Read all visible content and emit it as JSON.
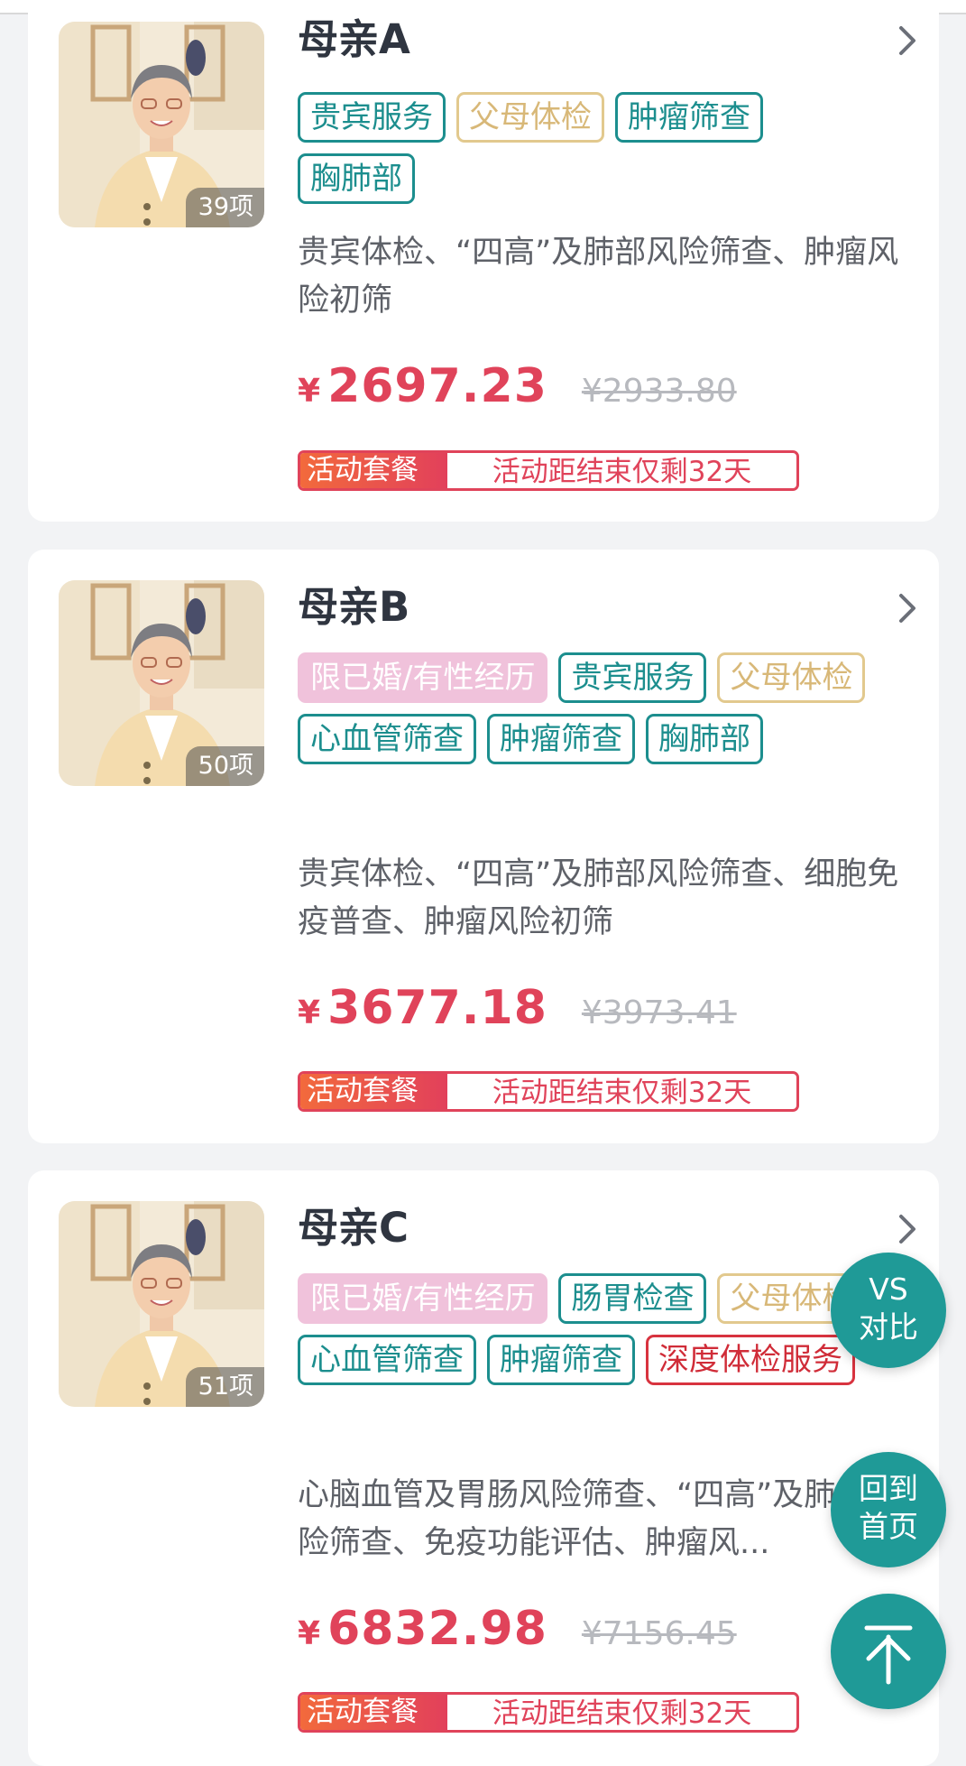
{
  "colors": {
    "accent_teal": "#1c8e8e",
    "price_red": "#e0435a",
    "tag_gold": "#d8b878",
    "tag_pink": "#f0c2db",
    "tag_red": "#d02c38",
    "fab_teal": "#1f9a97"
  },
  "packages": [
    {
      "title": "母亲A",
      "count": "39项",
      "tags": [
        {
          "label": "贵宾服务",
          "style": "teal"
        },
        {
          "label": "父母体检",
          "style": "gold"
        },
        {
          "label": "肿瘤筛查",
          "style": "teal"
        },
        {
          "label": "胸肺部",
          "style": "teal"
        }
      ],
      "description": "贵宾体检、“四高”及肺部风险筛查、肿瘤风险初筛",
      "currency": "¥",
      "price": "2697.23",
      "original_price": "¥2933.80",
      "promo_label": "活动套餐",
      "promo_text": "活动距结束仅剩32天",
      "chevron_icon": "chevron-right-icon"
    },
    {
      "title": "母亲B",
      "count": "50项",
      "tags": [
        {
          "label": "限已婚/有性经历",
          "style": "pink"
        },
        {
          "label": "贵宾服务",
          "style": "teal"
        },
        {
          "label": "父母体检",
          "style": "gold"
        },
        {
          "label": "心血管筛查",
          "style": "teal"
        },
        {
          "label": "肿瘤筛查",
          "style": "teal"
        },
        {
          "label": "胸肺部",
          "style": "teal"
        }
      ],
      "description": "贵宾体检、“四高”及肺部风险筛查、细胞免疫普查、肿瘤风险初筛",
      "currency": "¥",
      "price": "3677.18",
      "original_price": "¥3973.41",
      "promo_label": "活动套餐",
      "promo_text": "活动距结束仅剩32天",
      "chevron_icon": "chevron-right-icon"
    },
    {
      "title": "母亲C",
      "count": "51项",
      "tags": [
        {
          "label": "限已婚/有性经历",
          "style": "pink"
        },
        {
          "label": "肠胃检查",
          "style": "teal"
        },
        {
          "label": "父母体检",
          "style": "gold"
        },
        {
          "label": "心血管筛查",
          "style": "teal"
        },
        {
          "label": "肿瘤筛查",
          "style": "teal"
        },
        {
          "label": "深度体检服务",
          "style": "red"
        }
      ],
      "description": "心脑血管及胃肠风险筛查、“四高”及肺部风险筛查、免疫功能评估、肿瘤风...",
      "currency": "¥",
      "price": "6832.98",
      "original_price": "¥7156.45",
      "promo_label": "活动套餐",
      "promo_text": "活动距结束仅剩32天",
      "chevron_icon": "chevron-right-icon"
    }
  ],
  "floating": {
    "compare_line1": "VS",
    "compare_line2": "对比",
    "home_line1": "回到",
    "home_line2": "首页",
    "top_icon": "arrow-up-to-top-icon"
  }
}
